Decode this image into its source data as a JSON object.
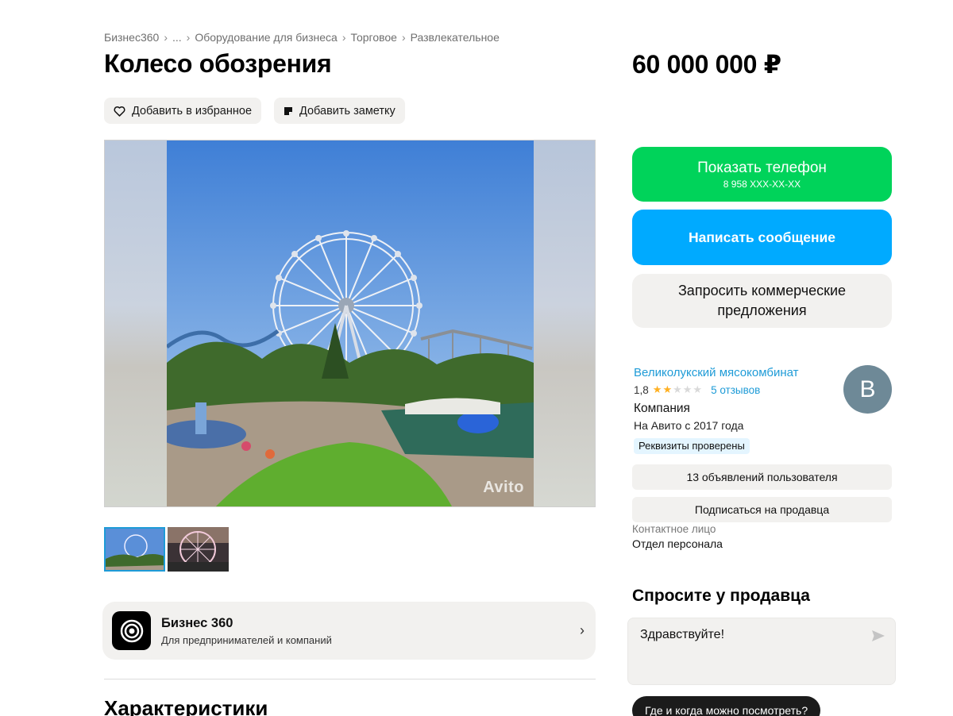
{
  "breadcrumb": {
    "items": [
      "Бизнес360",
      "...",
      "Оборудование для бизнеса",
      "Торговое",
      "Развлекательное"
    ],
    "separator": "›"
  },
  "listing": {
    "title": "Колесо обозрения",
    "price": "60 000 000 ₽",
    "watermark": "Avito"
  },
  "actions": {
    "favorite_label": "Добавить в избранное",
    "note_label": "Добавить заметку"
  },
  "business360": {
    "title": "Бизнес 360",
    "subtitle": "Для предпринимателей и компаний",
    "chevron": "›"
  },
  "sections": {
    "characteristics": "Характеристики"
  },
  "contact_buttons": {
    "show_phone": "Показать телефон",
    "phone_masked": "8 958 XXX-XX-XX",
    "write_message": "Написать сообщение",
    "request_offers_line1": "Запросить коммерческие",
    "request_offers_line2": "предложения"
  },
  "seller": {
    "name": "Великолукский мясокомбинат",
    "rating": "1,8",
    "rating_value": 1.8,
    "rating_max": 5,
    "reviews": "5 отзывов",
    "type": "Компания",
    "since": "На Авито с 2017 года",
    "verified": "Реквизиты проверены",
    "avatar_letter": "В",
    "listings_button": "13 объявлений пользователя",
    "subscribe_button": "Подписаться на продавца",
    "contact_label": "Контактное лицо",
    "contact_value": "Отдел персонала"
  },
  "ask": {
    "title": "Спросите у продавца",
    "message": "Здравствуйте!",
    "chip": "Где и когда можно посмотреть?"
  },
  "colors": {
    "green": "#00d35a",
    "blue": "#00aaff",
    "link": "#1e9bd7",
    "gray_bg": "#f2f1ef"
  }
}
